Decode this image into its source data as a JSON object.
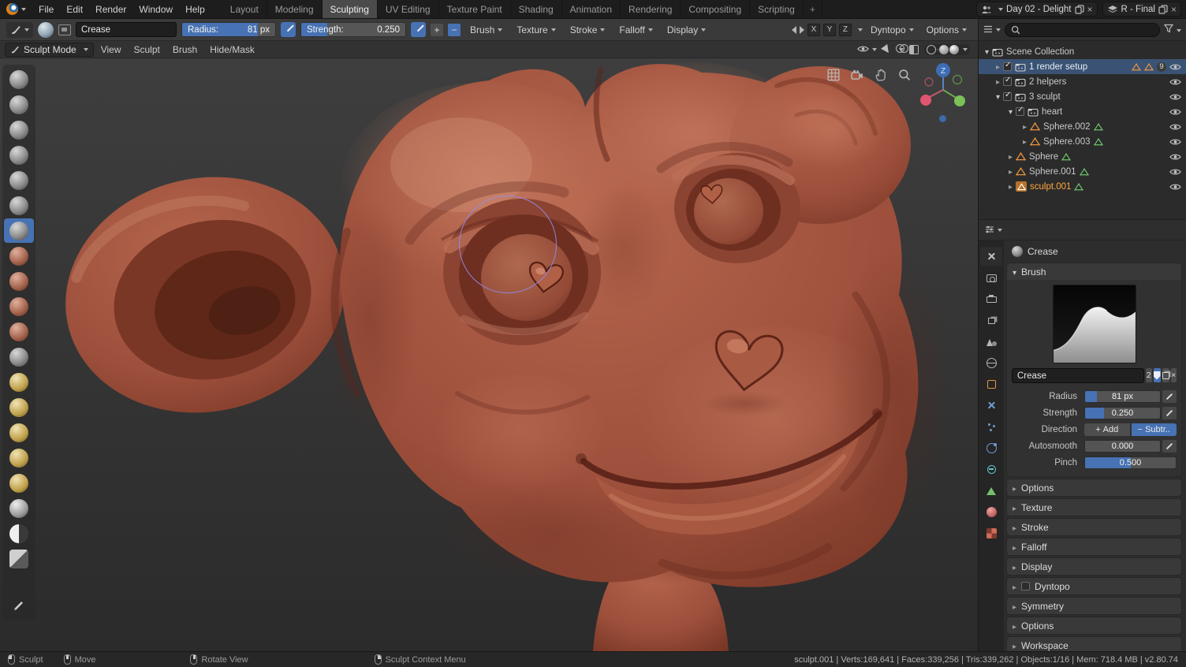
{
  "topbar": {
    "menus": [
      {
        "label": "File"
      },
      {
        "label": "Edit"
      },
      {
        "label": "Render"
      },
      {
        "label": "Window"
      },
      {
        "label": "Help"
      }
    ],
    "workspaces": [
      {
        "label": "Layout"
      },
      {
        "label": "Modeling"
      },
      {
        "label": "Sculpting"
      },
      {
        "label": "UV Editing"
      },
      {
        "label": "Texture Paint"
      },
      {
        "label": "Shading"
      },
      {
        "label": "Animation"
      },
      {
        "label": "Rendering"
      },
      {
        "label": "Compositing"
      },
      {
        "label": "Scripting"
      }
    ],
    "active_workspace": "Sculpting",
    "new_workspace_label": "+",
    "scene_name": "Day 02 - Delight",
    "view_layer_name": "R - Final"
  },
  "tool_header": {
    "brush_name": "Crease",
    "radius_label": "Radius:",
    "radius_value": "81 px",
    "radius_fill_pct": 81,
    "strength_label": "Strength:",
    "strength_value": "0.250",
    "strength_fill_pct": 25,
    "plus_label": "+",
    "minus_label": "−",
    "menus": [
      {
        "label": "Brush"
      },
      {
        "label": "Texture"
      },
      {
        "label": "Stroke"
      },
      {
        "label": "Falloff"
      },
      {
        "label": "Display"
      }
    ],
    "mirror_axes": [
      {
        "label": "X"
      },
      {
        "label": "Y"
      },
      {
        "label": "Z"
      }
    ],
    "dyntopo_label": "Dyntopo",
    "options_label": "Options"
  },
  "mode_header": {
    "mode_label": "Sculpt Mode",
    "menus": [
      {
        "label": "View"
      },
      {
        "label": "Sculpt"
      },
      {
        "label": "Brush"
      },
      {
        "label": "Hide/Mask"
      }
    ]
  },
  "toolbar": {
    "active_brush": "Crease",
    "brushes": [
      {
        "name": "Draw"
      },
      {
        "name": "Clay"
      },
      {
        "name": "Clay Strips"
      },
      {
        "name": "Layer"
      },
      {
        "name": "Inflate"
      },
      {
        "name": "Blob"
      },
      {
        "name": "Crease"
      },
      {
        "name": "Smooth"
      },
      {
        "name": "Flatten"
      },
      {
        "name": "Fill"
      },
      {
        "name": "Scrape"
      },
      {
        "name": "Pinch"
      },
      {
        "name": "Grab"
      },
      {
        "name": "Elastic Deform"
      },
      {
        "name": "Snake Hook"
      },
      {
        "name": "Thumb"
      },
      {
        "name": "Nudge"
      },
      {
        "name": "Rotate"
      },
      {
        "name": "Simplify"
      },
      {
        "name": "Mask"
      },
      {
        "name": "Annotate"
      }
    ]
  },
  "viewport": {
    "gizmo_z_label": "Z"
  },
  "outliner": {
    "root_label": "Scene Collection",
    "items": [
      {
        "label": "1 render setup",
        "badge": "9"
      },
      {
        "label": "2 helpers"
      },
      {
        "label": "3 sculpt"
      },
      {
        "label": "heart"
      },
      {
        "label": "Sphere.002"
      },
      {
        "label": "Sphere.003"
      },
      {
        "label": "Sphere"
      },
      {
        "label": "Sphere.001"
      },
      {
        "label": "sculpt.001"
      }
    ]
  },
  "properties": {
    "breadcrumb_brush": "Crease",
    "panels": {
      "brush": "Brush",
      "options": "Options",
      "texture": "Texture",
      "stroke": "Stroke",
      "falloff": "Falloff",
      "display": "Display",
      "dyntopo": "Dyntopo",
      "symmetry": "Symmetry",
      "options2": "Options",
      "workspace": "Workspace"
    },
    "brush_name_field": "Crease",
    "brush_users_count": "2",
    "radius_label": "Radius",
    "radius_value": "81 px",
    "strength_label": "Strength",
    "strength_value": "0.250",
    "direction_label": "Direction",
    "plus_glyph": "+",
    "minus_glyph": "−",
    "direction_add": "Add",
    "direction_subtract": "Subtr..",
    "autosmooth_label": "Autosmooth",
    "autosmooth_value": "0.000",
    "pinch_label": "Pinch",
    "pinch_value": "0.500"
  },
  "status_bar": {
    "hints": [
      {
        "label": "Sculpt"
      },
      {
        "label": "Move"
      },
      {
        "label": "Rotate View"
      },
      {
        "label": "Sculpt Context Menu"
      }
    ],
    "stats": "sculpt.001 | Verts:169,641 | Faces:339,256 | Tris:339,262 | Objects:1/16 | Mem: 718.4 MB | v2.80.74"
  },
  "colors": {
    "accent": "#4772b3",
    "active_object": "#ffa83c",
    "clay_base": "#9c4f3b",
    "cursor": "#8d82e0"
  }
}
